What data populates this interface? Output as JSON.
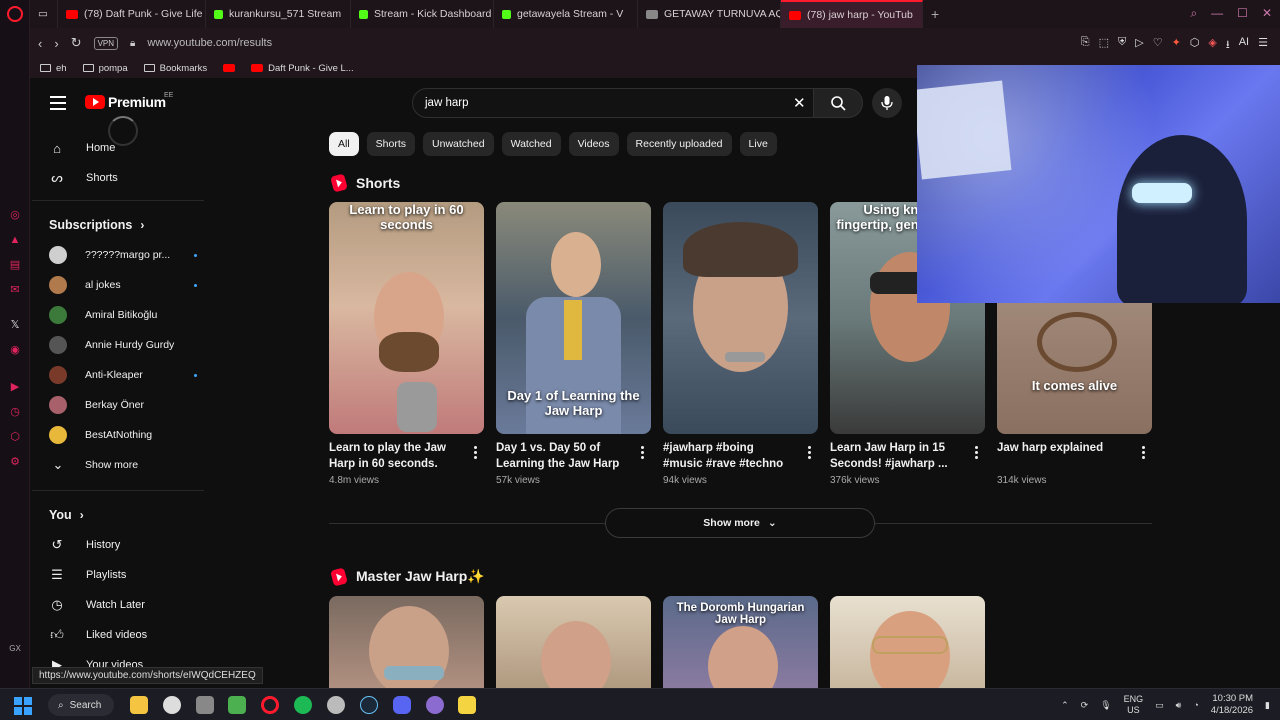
{
  "browser": {
    "tabs": [
      {
        "label": "(78) Daft Punk - Give Life",
        "color": "#ff0000"
      },
      {
        "label": "kurankursu_571 Stream",
        "color": "#53fc18"
      },
      {
        "label": "Stream - Kick Dashboard",
        "color": "#53fc18"
      },
      {
        "label": "getawayela Stream - V",
        "color": "#53fc18"
      },
      {
        "label": "GETAWAY TURNUVA AQ",
        "color": "#888888"
      },
      {
        "label": "(78) jaw harp - YouTub",
        "color": "#ff0000",
        "active": true
      }
    ],
    "vpn": "VPN",
    "url": "www.youtube.com/results",
    "bookmarks": [
      {
        "label": "eh",
        "type": "folder"
      },
      {
        "label": "pompa",
        "type": "folder"
      },
      {
        "label": "Bookmarks",
        "type": "folder"
      },
      {
        "label": "",
        "type": "youtube"
      },
      {
        "label": "Daft Punk - Give L...",
        "type": "youtube"
      }
    ],
    "status_url": "https://www.youtube.com/shorts/eIWQdCEHZEQ"
  },
  "youtube": {
    "logo": "Premium",
    "country": "EE",
    "search": {
      "query": "jaw harp"
    },
    "nav": [
      {
        "label": "Home",
        "icon": "home-icon"
      },
      {
        "label": "Shorts",
        "icon": "shorts-icon"
      }
    ],
    "subscriptions_title": "Subscriptions",
    "subscriptions": [
      {
        "label": "??????margo pr...",
        "color": "#cfcfcf",
        "new": true
      },
      {
        "label": "al jokes",
        "color": "#b07a4c",
        "new": true
      },
      {
        "label": "Amiral Bitikoğlu",
        "color": "#3b7a3a",
        "new": false
      },
      {
        "label": "Annie Hurdy Gurdy",
        "color": "#555555",
        "new": false
      },
      {
        "label": "Anti-Kleaper",
        "color": "#7a3a2a",
        "new": true
      },
      {
        "label": "Berkay Öner",
        "color": "#a8606a",
        "new": false
      },
      {
        "label": "BestAtNothing",
        "color": "#e8b83a",
        "new": false
      }
    ],
    "show_more_subs": "Show more",
    "you_title": "You",
    "you_items": [
      {
        "label": "History",
        "icon": "history-icon"
      },
      {
        "label": "Playlists",
        "icon": "playlists-icon"
      },
      {
        "label": "Watch Later",
        "icon": "watch-later-icon"
      },
      {
        "label": "Liked videos",
        "icon": "liked-icon"
      },
      {
        "label": "Your videos",
        "icon": "your-videos-icon"
      }
    ],
    "chips": [
      "All",
      "Shorts",
      "Unwatched",
      "Watched",
      "Videos",
      "Recently uploaded",
      "Live"
    ],
    "shelf1_title": "Shorts",
    "shorts": [
      {
        "title": "Learn to play the Jaw Harp in 60 seconds.",
        "views": "4.8m views",
        "caption": "Learn to play in 60 seconds",
        "bg": "#c9a98a"
      },
      {
        "title": "Day 1 vs. Day 50 of Learning the Jaw Harp",
        "views": "57k views",
        "caption": "Day 1 of Learning the Jaw Harp",
        "bg": "#6a7a8a"
      },
      {
        "title": "#jawharp #boing #music #rave #techno",
        "views": "94k views",
        "caption": "",
        "bg": "#4a5a6a"
      },
      {
        "title": "Learn Jaw Harp in 15 Seconds! #jawharp ...",
        "views": "376k views",
        "caption": "Using knuckle fingertip, gently trigger",
        "bg": "#7a8a8a"
      },
      {
        "title": "Jaw harp explained",
        "views": "314k views",
        "caption": "It comes alive",
        "bg": "#9a8a7a"
      }
    ],
    "show_more_shorts": "Show more",
    "shelf2_title": "Master Jaw Harp✨",
    "shelf2_captions": [
      "",
      "",
      "The Doromb Hungarian Jaw Harp",
      ""
    ]
  },
  "taskbar": {
    "search": "Search",
    "lang1": "ENG",
    "lang2": "US",
    "time": "10:30 PM",
    "date": "4/18/2026"
  }
}
